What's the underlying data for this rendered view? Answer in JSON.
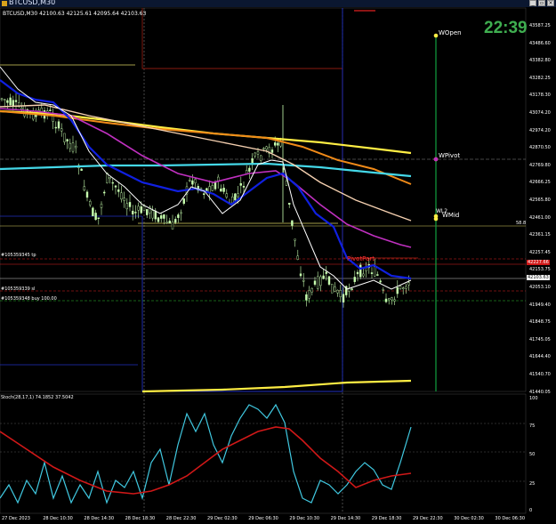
{
  "window": {
    "title": "BTCUSD,M30"
  },
  "main": {
    "ohlc": "BTCUSD,M30  42100.63 42125.61 42095.64 42103.63",
    "clock": "22:39",
    "levels": {
      "wopen": "WOpen",
      "wpivot": "WPivot",
      "wmid": "WMid",
      "wx": "WL2"
    },
    "right_small": "58.8",
    "pivot_part": "PivotPart",
    "orders": {
      "tp": "#105359345 tp",
      "sl": "#105359339 sl",
      "buy": "#105359348 buy 100.00"
    },
    "price_axis": [
      "43587.25",
      "43486.60",
      "43382.80",
      "43282.25",
      "43178.30",
      "43074.20",
      "42974.20",
      "42870.50",
      "42769.80",
      "42666.25",
      "42565.80",
      "42461.00",
      "42361.15",
      "42257.45",
      "42153.75",
      "42053.10",
      "41949.40",
      "41848.75",
      "41745.05",
      "41644.40",
      "41540.70",
      "41440.05"
    ],
    "price_tag_red": "42227.66",
    "price_tag_cur": "42103.63"
  },
  "oscillator": {
    "label": "Stoch(28,17,1) 74.1852 37.5042",
    "axis": [
      "100",
      "75",
      "50",
      "25",
      "0"
    ]
  },
  "time_axis": [
    "27 Dec 2023",
    "28 Dec 10:30",
    "28 Dec 14:30",
    "28 Dec 18:30",
    "28 Dec 22:30",
    "29 Dec 02:30",
    "29 Dec 06:30",
    "29 Dec 10:30",
    "29 Dec 14:30",
    "29 Dec 18:30",
    "29 Dec 22:30",
    "30 Dec 02:30",
    "30 Dec 06:30"
  ],
  "colors": {
    "bg": "#000000",
    "candle": "#c8ffb0",
    "yellow": "#ffee44",
    "orange": "#f08a18",
    "cyan": "#44d8e8",
    "blue": "#1020e0",
    "magenta": "#c030c0",
    "peach": "#f5d0b0",
    "white": "#ffffff",
    "green_v": "#10a040",
    "red": "#e02020",
    "stoch_main": "#40c8e0",
    "stoch_signal": "#d01818",
    "clock": "#3fae50"
  }
}
